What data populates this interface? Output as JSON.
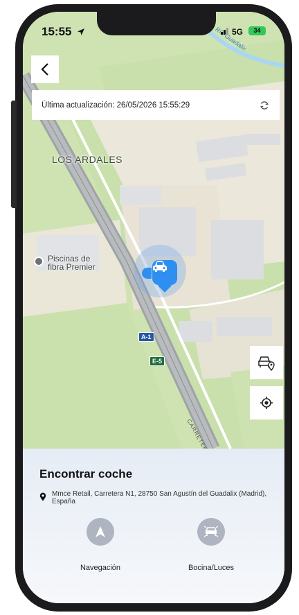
{
  "status_bar": {
    "time": "15:55",
    "network": "5G",
    "battery": "34"
  },
  "map": {
    "area_label": "LOS ARDALES",
    "poi_label_line1": "Piscinas de",
    "poi_label_line2": "fibra Premier",
    "road_shield_1": "A-1",
    "road_shield_2": "E-5",
    "road_name": "CARRETER",
    "river_name": "Río Guadalix"
  },
  "header": {
    "back_icon": "chevron-left-icon",
    "last_update": "Última actualización: 26/05/2026 15:55:29",
    "refresh_icon": "refresh-icon"
  },
  "map_controls": {
    "vehicle_location_icon": "car-location-icon",
    "my_location_icon": "crosshair-icon"
  },
  "sheet": {
    "title": "Encontrar coche",
    "address": "Mmce Retail, Carretera N1, 28750 San Agustín del Guadalix (Madrid), España",
    "actions": [
      {
        "label": "Navegación",
        "icon": "navigation-arrow-icon"
      },
      {
        "label": "Bocina/Luces",
        "icon": "horn-lights-icon"
      }
    ]
  },
  "colors": {
    "accent": "#2e8ff0",
    "action_button": "#aeb4c0",
    "map_green": "#cfe3b2"
  }
}
